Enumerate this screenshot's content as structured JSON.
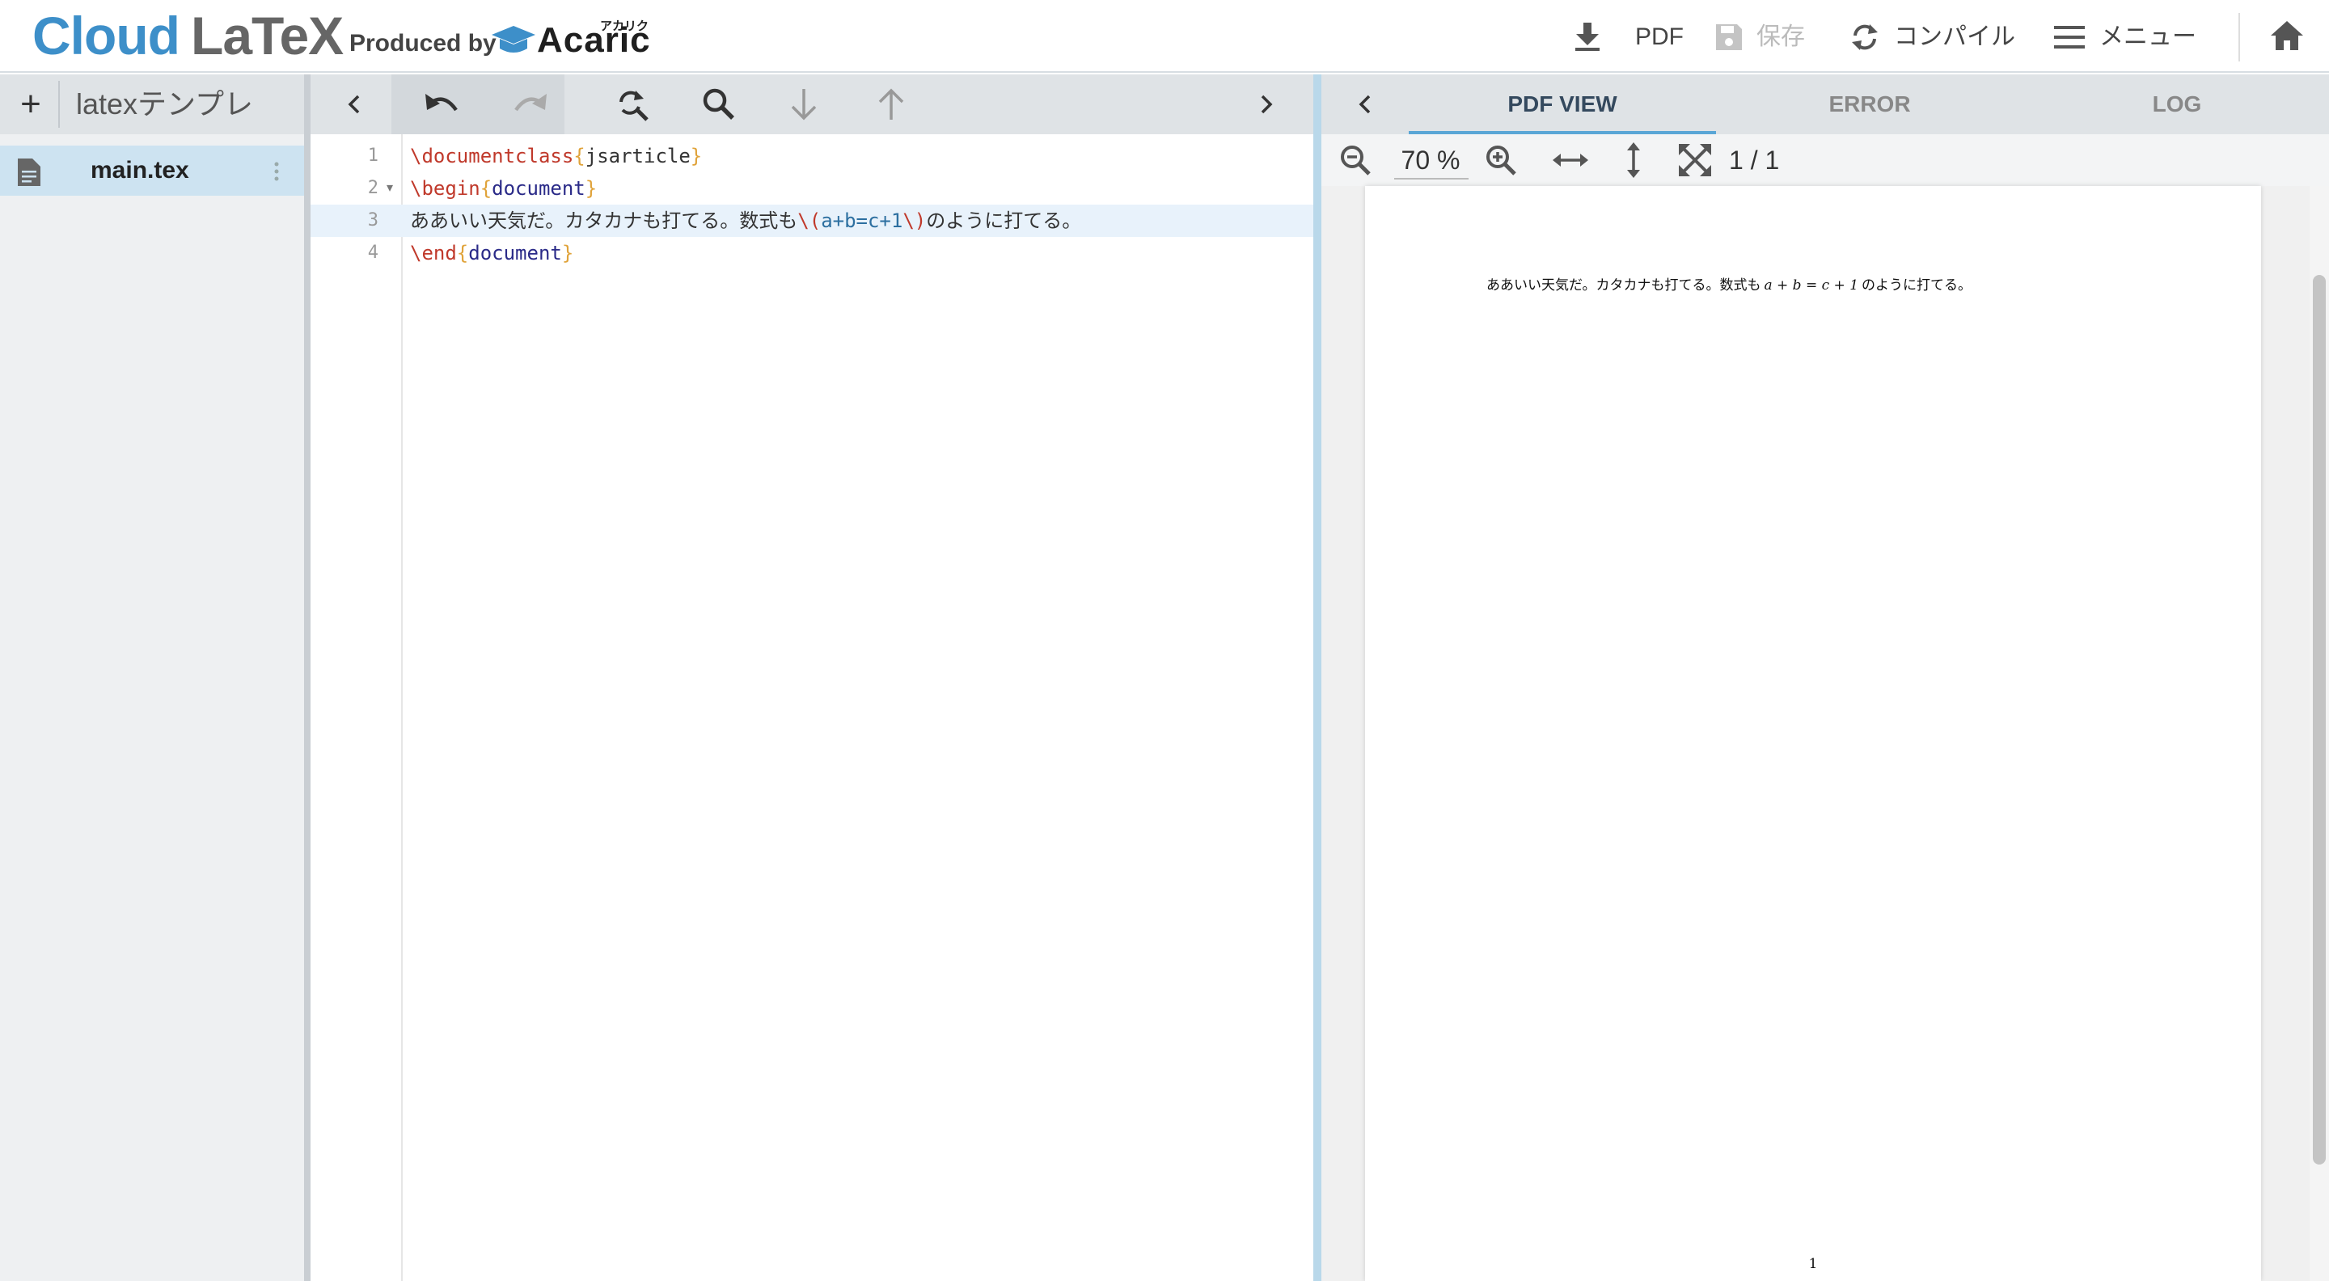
{
  "brand": {
    "cloud": "Cloud",
    "latex": "LaTeX",
    "produced_by": "Produced by",
    "acaric": "Acaric",
    "acaric_kana": "アカリク",
    "cloud_color": "#3d8fc9",
    "latex_color": "#666666"
  },
  "header": {
    "pdf_label": "PDF",
    "save_label": "保存",
    "compile_label": "コンパイル",
    "menu_label": "メニュー",
    "icons": [
      "download-icon",
      "save-icon",
      "sync-icon",
      "hamburger-icon",
      "home-icon"
    ]
  },
  "files": {
    "add_label": "+",
    "project_name": "latexテンプレ",
    "items": [
      {
        "name": "main.tex",
        "selected": true,
        "icon": "file-icon"
      }
    ]
  },
  "editor": {
    "toolbar_icons": [
      "chevron-left-icon",
      "undo-icon",
      "redo-icon",
      "replace-icon",
      "search-icon",
      "arrow-down-icon",
      "arrow-up-icon",
      "chevron-right-icon"
    ],
    "active_line": 3,
    "lines": [
      {
        "num": "1",
        "segments": [
          [
            "kw",
            "\\documentclass"
          ],
          [
            "br",
            "{"
          ],
          [
            "p",
            "jsarticle"
          ],
          [
            "br",
            "}"
          ]
        ]
      },
      {
        "num": "2",
        "fold": "▾",
        "segments": [
          [
            "kw",
            "\\begin"
          ],
          [
            "br",
            "{"
          ],
          [
            "id",
            "document"
          ],
          [
            "br",
            "}"
          ]
        ]
      },
      {
        "num": "3",
        "segments": [
          [
            "p",
            "ああいい天気だ。カタカナも打てる。数式も"
          ],
          [
            "kw",
            "\\("
          ],
          [
            "m",
            "a+b=c+1"
          ],
          [
            "kw",
            "\\)"
          ],
          [
            "p",
            "のように打てる。"
          ]
        ]
      },
      {
        "num": "4",
        "segments": [
          [
            "kw",
            "\\end"
          ],
          [
            "br",
            "{"
          ],
          [
            "id",
            "document"
          ],
          [
            "br",
            "}"
          ]
        ]
      }
    ]
  },
  "pdf": {
    "tabs": [
      {
        "label": "PDF VIEW",
        "active": true
      },
      {
        "label": "ERROR",
        "active": false
      },
      {
        "label": "LOG",
        "active": false
      }
    ],
    "zoom": "70 %",
    "page_indicator": "1 / 1",
    "tool_icons": [
      "zoom-out-icon",
      "zoom-in-icon",
      "fit-width-icon",
      "fit-height-icon",
      "fullscreen-icon"
    ],
    "page_text_before": "ああいい天気だ。カタカナも打てる。数式も",
    "page_math": "a + b = c + 1",
    "page_text_after": "のように打てる。",
    "page_number": "1"
  },
  "colors": {
    "accent": "#3d8fc9",
    "tab_underline": "#5aa6d6",
    "selected_file_bg": "#cde3f1",
    "active_line_bg": "#e8f2fb"
  }
}
